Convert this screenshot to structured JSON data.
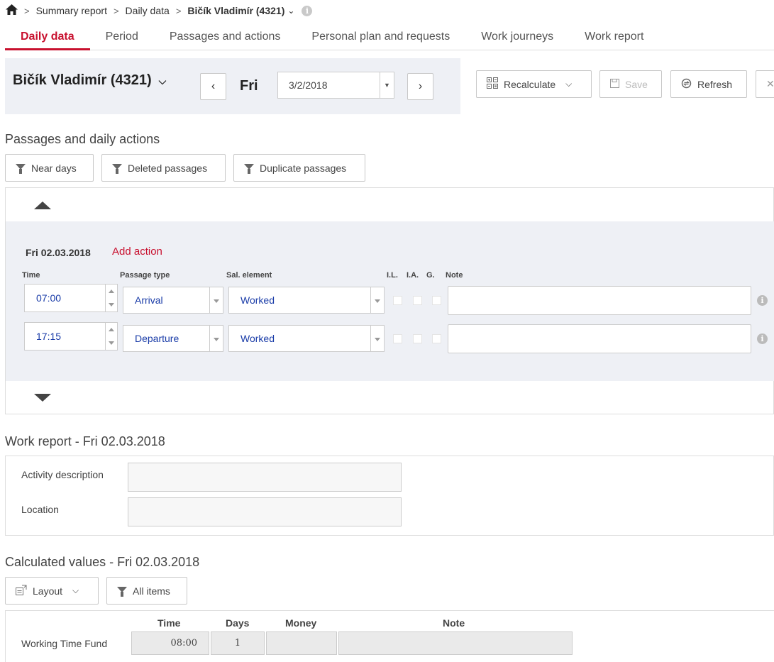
{
  "breadcrumb": {
    "items": [
      "Summary report",
      "Daily data"
    ],
    "current": "Bičík Vladimír (4321)",
    "caret": "⌄",
    "info": "i"
  },
  "tabs": [
    {
      "label": "Daily data",
      "active": true
    },
    {
      "label": "Period"
    },
    {
      "label": "Passages and actions"
    },
    {
      "label": "Personal plan and requests"
    },
    {
      "label": "Work journeys"
    },
    {
      "label": "Work report"
    }
  ],
  "header": {
    "person": "Bičík Vladimír (4321)",
    "day": "Fri",
    "date": "3/2/2018"
  },
  "toolbar": {
    "recalculate": "Recalculate",
    "save": "Save",
    "refresh": "Refresh"
  },
  "passages": {
    "title": "Passages and daily actions",
    "filters": [
      "Near days",
      "Deleted passages",
      "Duplicate passages"
    ],
    "day_label": "Fri 02.03.2018",
    "add_action": "Add action",
    "columns": {
      "time": "Time",
      "passage_type": "Passage type",
      "sal_element": "Sal. element",
      "il": "I.L.",
      "ia": "I.A.",
      "g": "G.",
      "note": "Note"
    },
    "rows": [
      {
        "time": "07:00",
        "type": "Arrival",
        "element": "Worked",
        "note": ""
      },
      {
        "time": "17:15",
        "type": "Departure",
        "element": "Worked",
        "note": ""
      }
    ]
  },
  "work_report": {
    "title": "Work report - Fri 02.03.2018",
    "activity_label": "Activity description",
    "activity_value": "",
    "location_label": "Location",
    "location_value": ""
  },
  "calculated": {
    "title": "Calculated values - Fri 02.03.2018",
    "layout": "Layout",
    "all_items": "All items",
    "columns": [
      "Time",
      "Days",
      "Money",
      "Note"
    ],
    "rows": [
      {
        "label": "Working Time Fund",
        "time": "08:00",
        "days": "1",
        "money": "",
        "note": ""
      }
    ]
  },
  "colors": {
    "accent": "#c8102e",
    "value_text": "#1a3ca8",
    "panel_bg": "#eef0f5"
  }
}
